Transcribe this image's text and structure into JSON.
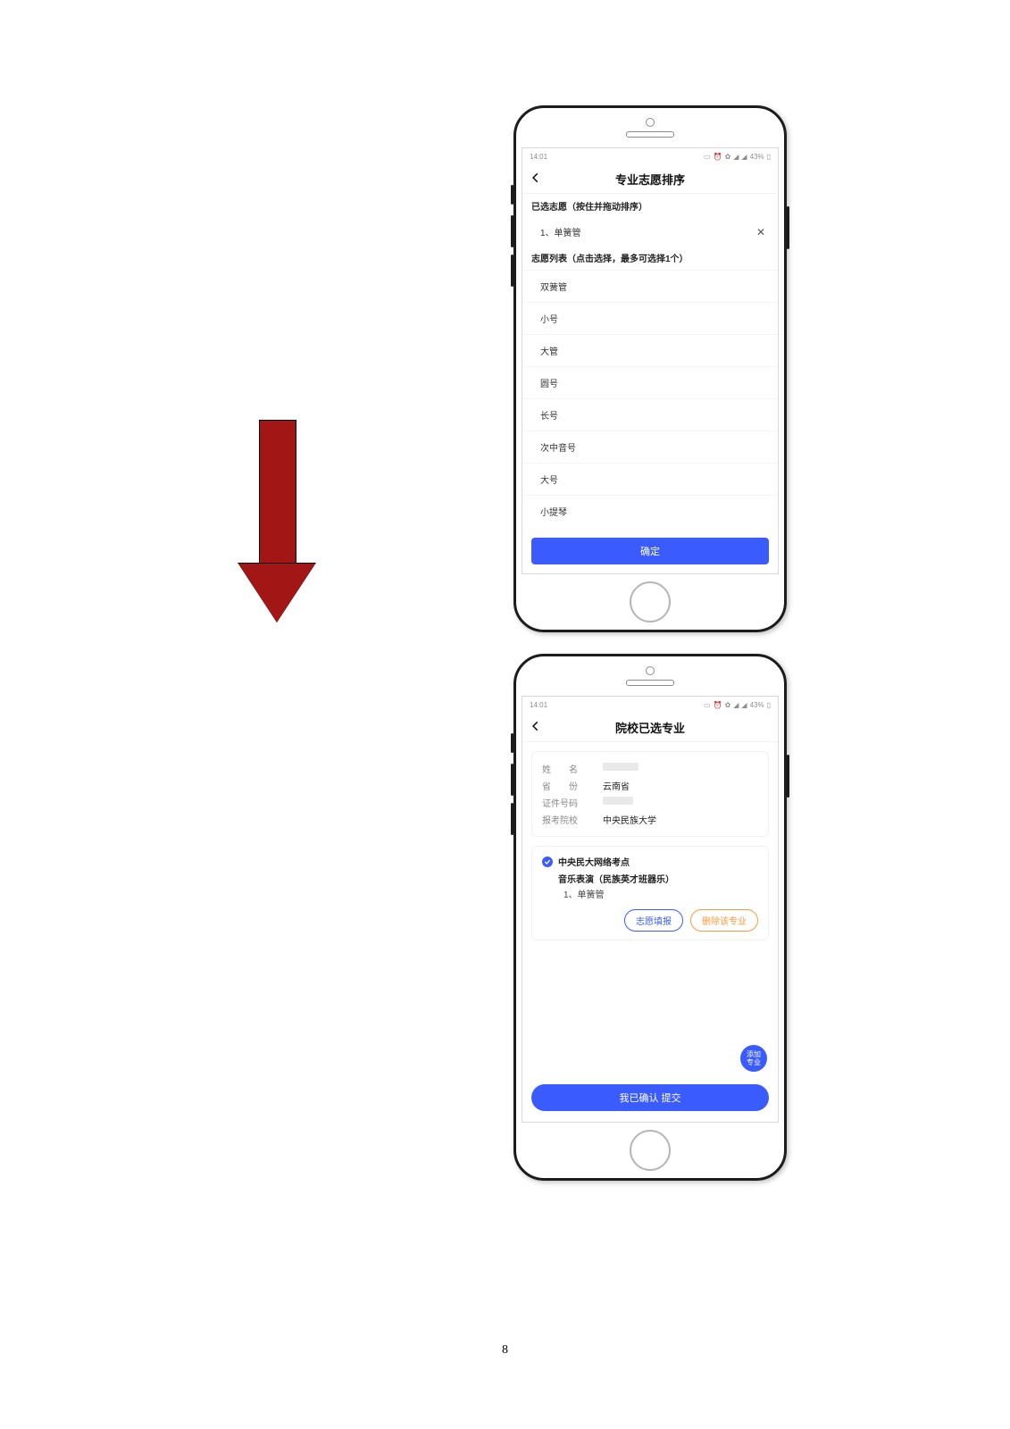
{
  "page_number": "8",
  "statusbar": {
    "time": "14:01",
    "battery": "43%"
  },
  "screen1": {
    "title": "专业志愿排序",
    "selected_header": "已选志愿（按住并拖动排序）",
    "selected_item": "1、单簧管",
    "list_header": "志愿列表（点击选择，最多可选择1个）",
    "options": [
      "双簧管",
      "小号",
      "大管",
      "圆号",
      "长号",
      "次中音号",
      "大号",
      "小提琴"
    ],
    "confirm": "确定"
  },
  "screen2": {
    "title": "院校已选专业",
    "info": {
      "name_label": "姓　　名",
      "province_label": "省　　份",
      "province_value": "云南省",
      "id_label": "证件号码",
      "school_label": "报考院校",
      "school_value": "中央民族大学"
    },
    "card": {
      "site": "中央民大网络考点",
      "major": "音乐表演（民族英才班器乐）",
      "choice": "1、单簧管",
      "pill_fill": "志愿填报",
      "pill_delete": "删除该专业"
    },
    "fab": "添加专业",
    "submit": "我已确认 提交"
  }
}
